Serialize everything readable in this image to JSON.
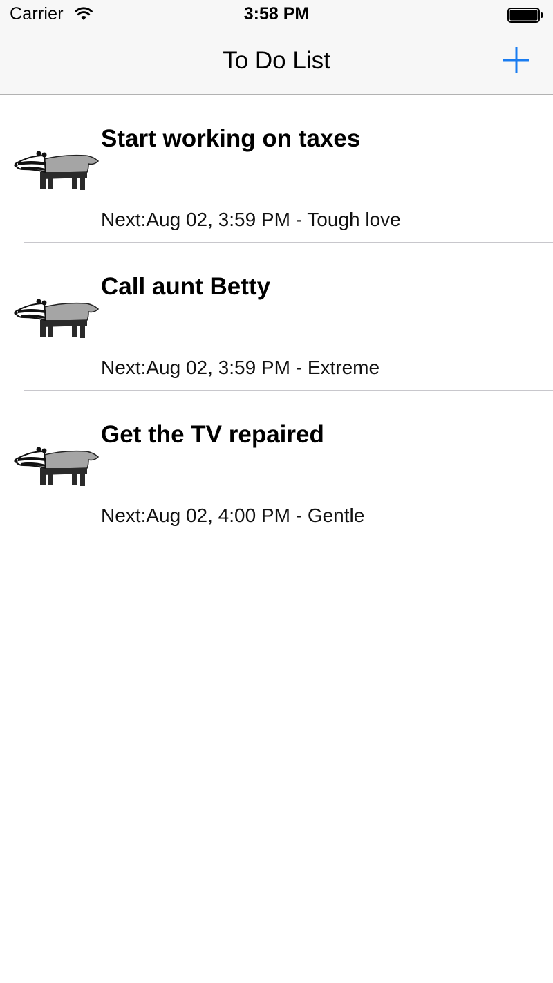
{
  "status_bar": {
    "carrier": "Carrier",
    "time": "3:58 PM",
    "icons": [
      "wifi-icon",
      "battery-icon"
    ]
  },
  "nav": {
    "title": "To Do List",
    "add_icon": "plus-icon"
  },
  "colors": {
    "tint": "#1a7cf0",
    "separator": "#c8c7cc",
    "bar_background": "#f7f7f7"
  },
  "todos": [
    {
      "title": "Start working on taxes",
      "subtitle": "Next:Aug 02, 3:59 PM - Tough love",
      "icon": "badger-icon"
    },
    {
      "title": "Call aunt Betty",
      "subtitle": "Next:Aug 02, 3:59 PM - Extreme",
      "icon": "badger-icon"
    },
    {
      "title": "Get the TV repaired",
      "subtitle": "Next:Aug 02, 4:00 PM - Gentle",
      "icon": "badger-icon"
    }
  ]
}
